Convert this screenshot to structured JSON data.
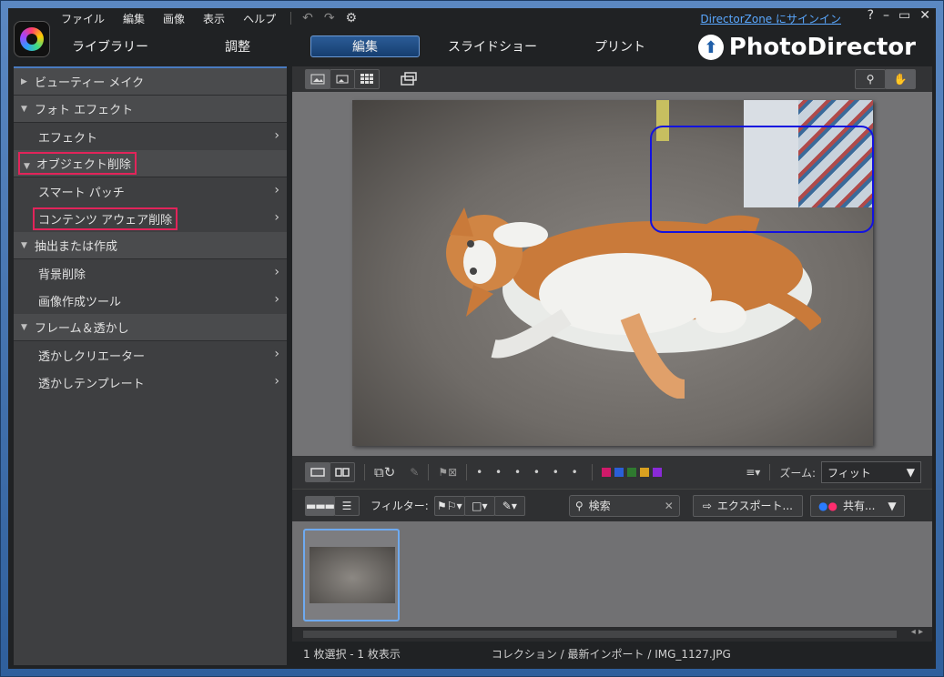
{
  "menu": {
    "items": [
      "ファイル",
      "編集",
      "画像",
      "表示",
      "ヘルプ"
    ],
    "signin": "DirectorZone にサインイン",
    "help": "?"
  },
  "tabs": [
    {
      "label": "ライブラリー",
      "active": false
    },
    {
      "label": "調整",
      "active": false
    },
    {
      "label": "編集",
      "active": true
    },
    {
      "label": "スライドショー",
      "active": false
    },
    {
      "label": "プリント",
      "active": false
    }
  ],
  "brand": "PhotoDirector",
  "panel": {
    "sections": [
      {
        "label": "ビューティー メイク",
        "expanded": false,
        "items": []
      },
      {
        "label": "フォト エフェクト",
        "expanded": true,
        "items": [
          "エフェクト"
        ]
      },
      {
        "label": "オブジェクト削除",
        "expanded": true,
        "highlighted": true,
        "items": [
          "スマート パッチ",
          "コンテンツ アウェア削除"
        ]
      },
      {
        "label": "抽出または作成",
        "expanded": true,
        "items": [
          "背景削除",
          "画像作成ツール"
        ]
      },
      {
        "label": "フレーム＆透かし",
        "expanded": true,
        "items": [
          "透かしクリエーター",
          "透かしテンプレート"
        ]
      }
    ],
    "highlighted_item": "コンテンツ アウェア削除"
  },
  "toolbar": {
    "zoom_label": "ズーム:",
    "zoom_value": "フィット",
    "dots": "• • • • • •",
    "color_labels": [
      "#d01a6a",
      "#2a5fd8",
      "#2f7a2f",
      "#d8a020",
      "#8a2ad8"
    ]
  },
  "filmbar": {
    "filter_label": "フィルター:",
    "search_placeholder": "検索",
    "export_label": "エクスポート...",
    "share_label": "共有..."
  },
  "status": {
    "selection": "1 枚選択 - 1 枚表示",
    "path": "コレクション / 最新インポート / IMG_1127.JPG"
  }
}
